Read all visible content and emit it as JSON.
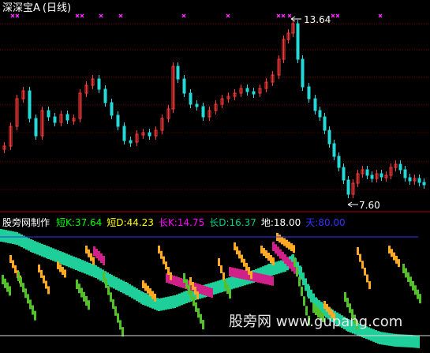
{
  "title": "深深宝A",
  "period": "(日线)",
  "price_high_label": "13.64",
  "price_low_label": "7.60",
  "indicator": {
    "name": "股旁网制作",
    "items": [
      {
        "label": "短K:37.64",
        "color": "#00ff00"
      },
      {
        "label": "短D:44.23",
        "color": "#ffff00"
      },
      {
        "label": "长K:14.75",
        "color": "#ff00ff"
      },
      {
        "label": "长D:16.37",
        "color": "#00cc88"
      },
      {
        "label": "地:18.00",
        "color": "#ffffff"
      },
      {
        "label": "天:80.00",
        "color": "#3333ff"
      }
    ]
  },
  "watermark": "股旁网 www.gupang.com",
  "colors": {
    "up": "#ff3b3b",
    "down": "#26d9d9",
    "marker": "#ff33ff",
    "short_k": "#55c12a",
    "short_d": "#ffaa22",
    "long_k": "#d0208a",
    "long_d": "#1fcf9a",
    "grid": "#7a0000"
  }
}
